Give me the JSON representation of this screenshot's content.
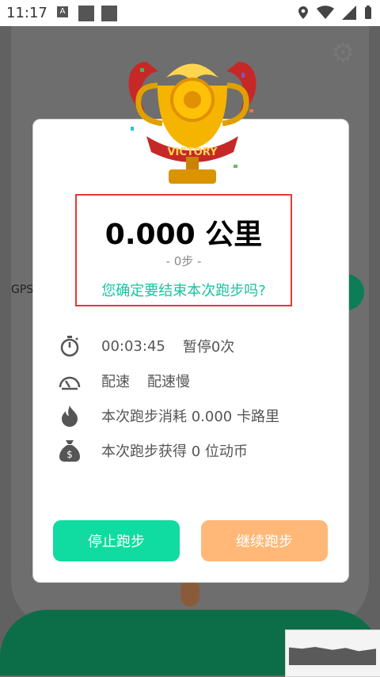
{
  "status_bar": {
    "time": "11:17",
    "a_label": "A"
  },
  "background": {
    "gps_label": "GPS"
  },
  "dialog": {
    "distance": "0.000 公里",
    "steps": "- 0步 -",
    "question": "您确定要结束本次跑步吗?",
    "trophy_text": "VICTORY",
    "rows": [
      {
        "icon": "stopwatch-icon",
        "value": "00:03:45",
        "extra": "暂停0次"
      },
      {
        "icon": "speedometer-icon",
        "value": "配速",
        "extra": "配速慢"
      },
      {
        "icon": "flame-icon",
        "value": "本次跑步消耗 0.000 卡路里",
        "extra": ""
      },
      {
        "icon": "money-bag-icon",
        "value": "本次跑步获得 0 位动币",
        "extra": ""
      }
    ],
    "stop_button": "停止跑步",
    "continue_button": "继续跑步"
  },
  "colors": {
    "accent_teal": "#17c3a0",
    "stop_green": "#10dba0",
    "continue_orange": "#ffb877",
    "highlight_red": "#e53935"
  }
}
